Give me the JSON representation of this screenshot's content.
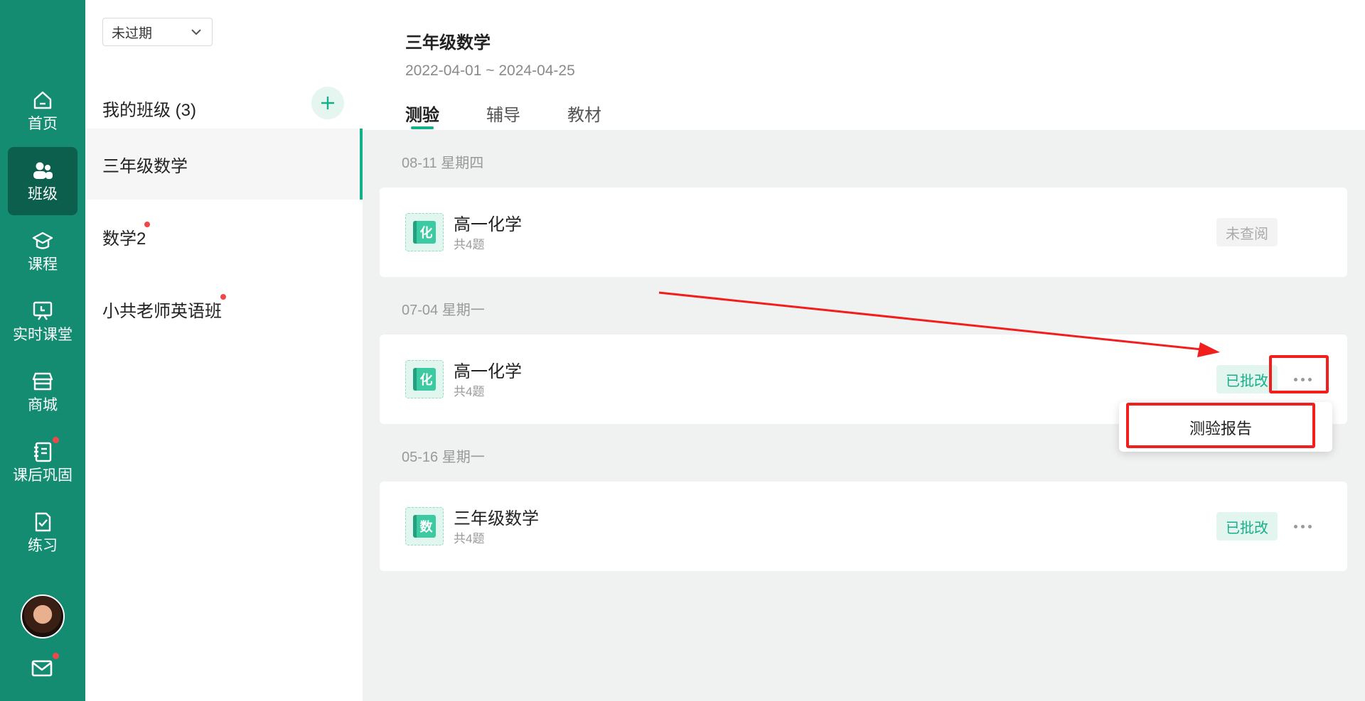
{
  "nav": {
    "items": [
      {
        "label": "首页",
        "icon": "home-icon"
      },
      {
        "label": "班级",
        "icon": "users-icon"
      },
      {
        "label": "课程",
        "icon": "graduation-cap-icon"
      },
      {
        "label": "实时课堂",
        "icon": "live-class-icon"
      },
      {
        "label": "商城",
        "icon": "store-icon"
      },
      {
        "label": "课后巩固",
        "icon": "notebook-icon"
      },
      {
        "label": "练习",
        "icon": "practice-icon"
      }
    ],
    "active_label": "班级"
  },
  "panel": {
    "filter_select": "未过期",
    "title": "我的班级 (3)",
    "classes": [
      {
        "name": "三年级数学"
      },
      {
        "name": "数学2"
      },
      {
        "name": "小共老师英语班"
      }
    ]
  },
  "header": {
    "title": "三年级数学",
    "date_range": "2022-04-01 ~ 2024-04-25",
    "tabs": [
      {
        "label": "测验"
      },
      {
        "label": "辅导"
      },
      {
        "label": "教材"
      }
    ]
  },
  "groups": [
    {
      "date": "08-11 星期四",
      "title": "高一化学",
      "count": "共4题",
      "icon_char": "化",
      "status": "未查阅"
    },
    {
      "date": "07-04 星期一",
      "title": "高一化学",
      "count": "共4题",
      "icon_char": "化",
      "status": "已批改"
    },
    {
      "date": "05-16 星期一",
      "title": "三年级数学",
      "count": "共4题",
      "icon_char": "数",
      "status": "已批改"
    }
  ],
  "dropdown": {
    "item": "测验报告"
  },
  "colors": {
    "primary": "#148c72",
    "accent": "#14b08a",
    "annotation": "#f21e1e"
  }
}
